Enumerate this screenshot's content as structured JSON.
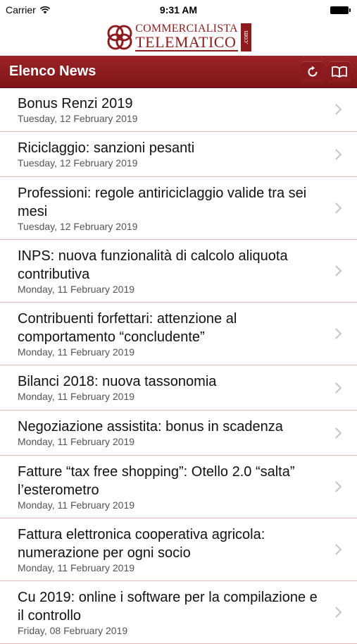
{
  "status_bar": {
    "carrier": "Carrier",
    "time": "9:31 AM"
  },
  "logo": {
    "line1": "COMMERCIALISTA",
    "line2": "TELEMATICO",
    "suffix": ".com"
  },
  "nav": {
    "title": "Elenco News",
    "refresh_icon": "refresh-icon",
    "book_icon": "book-icon"
  },
  "news": [
    {
      "title": "Bonus Renzi 2019",
      "date": "Tuesday, 12 February 2019"
    },
    {
      "title": "Riciclaggio: sanzioni pesanti",
      "date": "Tuesday, 12 February 2019"
    },
    {
      "title": "Professioni: regole antiriciclaggio valide tra sei mesi",
      "date": "Tuesday, 12 February 2019"
    },
    {
      "title": "INPS: nuova funzionalità di calcolo aliquota contributiva",
      "date": "Monday, 11 February 2019"
    },
    {
      "title": "Contribuenti forfettari: attenzione al comportamento “concludente”",
      "date": "Monday, 11 February 2019"
    },
    {
      "title": "Bilanci 2018: nuova tassonomia",
      "date": "Monday, 11 February 2019"
    },
    {
      "title": "Negoziazione assistita: bonus in scadenza",
      "date": "Monday, 11 February 2019"
    },
    {
      "title": "Fatture “tax free shopping”: Otello 2.0 “salta” l’esterometro",
      "date": "Monday, 11 February 2019"
    },
    {
      "title": "Fattura elettronica cooperativa agricola: numerazione per ogni socio",
      "date": "Monday, 11 February 2019"
    },
    {
      "title": "Cu 2019: online i software per la compilazione e il controllo",
      "date": "Friday, 08 February 2019"
    }
  ],
  "colors": {
    "brand": "#8e1c1f",
    "separator": "#e3b8ba"
  }
}
